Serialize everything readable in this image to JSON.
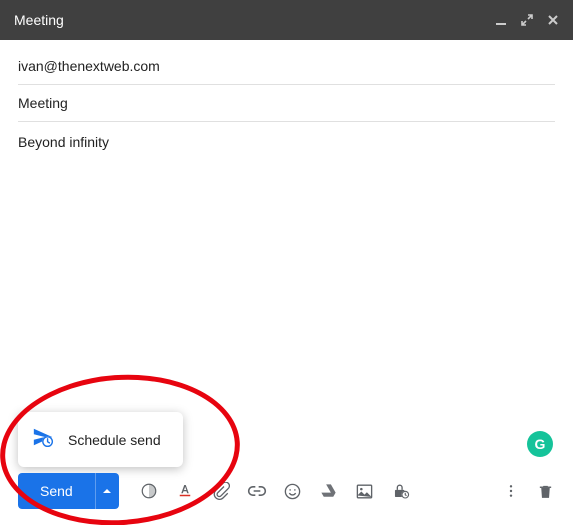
{
  "header": {
    "title": "Meeting"
  },
  "fields": {
    "to": "ivan@thenextweb.com",
    "subject": "Meeting"
  },
  "body": "Beyond infinity",
  "toolbar": {
    "send_label": "Send"
  },
  "schedule_menu": {
    "label": "Schedule send"
  },
  "grammarly": {
    "letter": "G"
  }
}
